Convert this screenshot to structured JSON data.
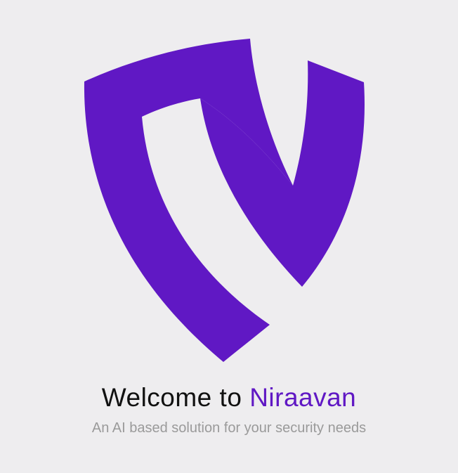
{
  "colors": {
    "background": "#eeedef",
    "brand": "#6018c4",
    "title_text": "#111111",
    "subtitle_text": "#9a9a9a"
  },
  "logo": {
    "icon": "shield-icon"
  },
  "welcome": {
    "prefix": "Welcome to ",
    "brand_name": "Niraavan",
    "tagline": "An AI based solution for your security needs"
  }
}
